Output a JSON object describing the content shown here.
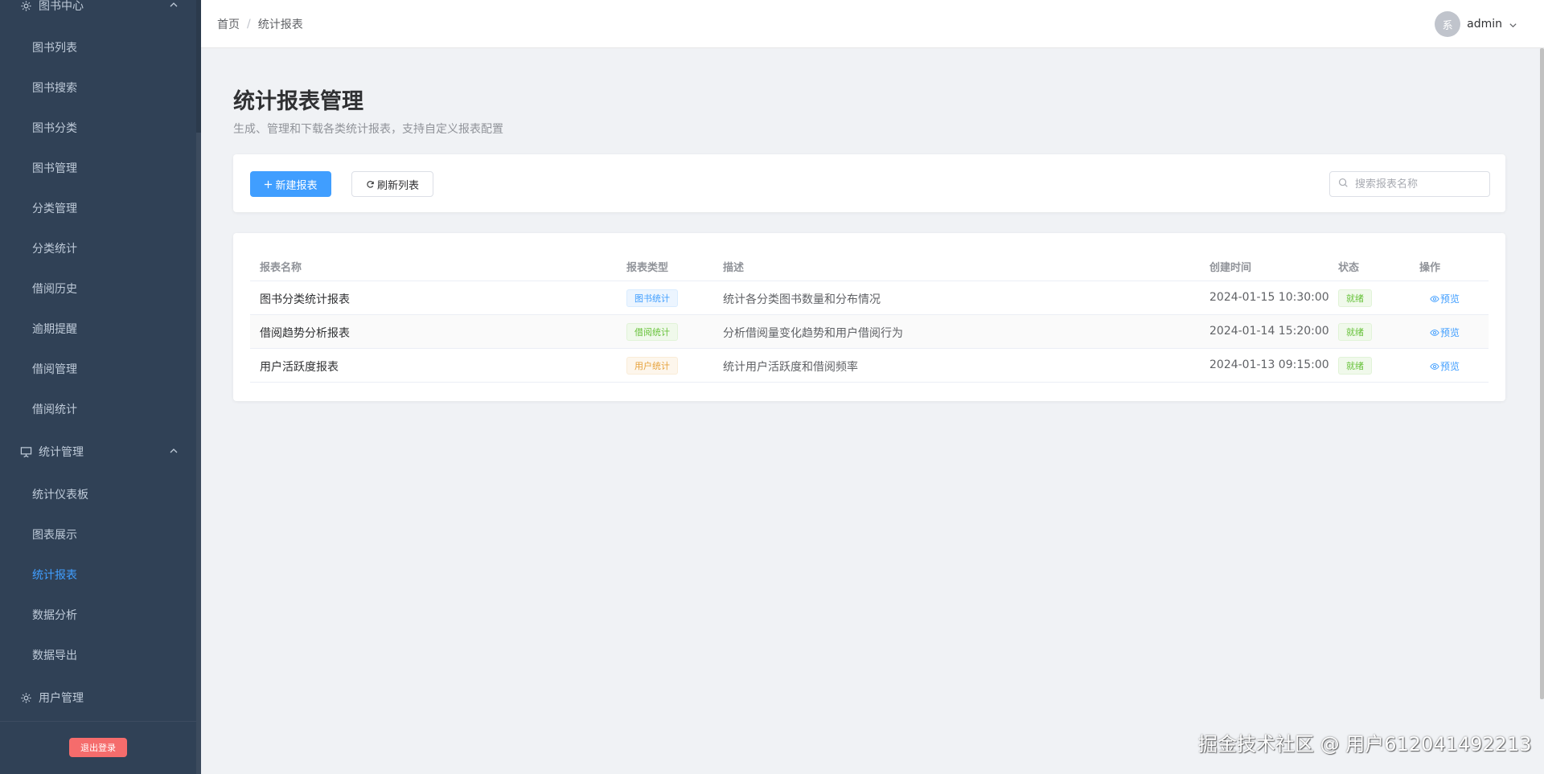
{
  "sidebar": {
    "group_books": {
      "label": "图书中心"
    },
    "book_items": [
      {
        "label": "图书列表"
      },
      {
        "label": "图书搜索"
      },
      {
        "label": "图书分类"
      },
      {
        "label": "图书管理"
      },
      {
        "label": "分类管理"
      },
      {
        "label": "分类统计"
      },
      {
        "label": "借阅历史"
      },
      {
        "label": "逾期提醒"
      },
      {
        "label": "借阅管理"
      },
      {
        "label": "借阅统计"
      }
    ],
    "group_stats": {
      "label": "统计管理"
    },
    "stats_items": [
      {
        "label": "统计仪表板"
      },
      {
        "label": "图表展示"
      },
      {
        "label": "统计报表",
        "active": true
      },
      {
        "label": "数据分析"
      },
      {
        "label": "数据导出"
      }
    ],
    "group_users": {
      "label": "用户管理"
    },
    "logout_label": "退出登录"
  },
  "header": {
    "breadcrumb": [
      "首页",
      "统计报表"
    ],
    "breadcrumb_separator": "/",
    "avatar_text": "系",
    "username": "admin"
  },
  "page": {
    "title": "统计报表管理",
    "subtitle": "生成、管理和下载各类统计报表，支持自定义报表配置"
  },
  "toolbar": {
    "new_report_label": "新建报表",
    "refresh_label": "刷新列表",
    "search_placeholder": "搜索报表名称"
  },
  "table": {
    "columns": [
      "报表名称",
      "报表类型",
      "描述",
      "创建时间",
      "状态",
      "操作"
    ],
    "rows": [
      {
        "name": "图书分类统计报表",
        "type": "图书统计",
        "type_color": "blue",
        "description": "统计各分类图书数量和分布情况",
        "created": "2024-01-15 10:30:00",
        "status": "就绪",
        "action": "预览"
      },
      {
        "name": "借阅趋势分析报表",
        "type": "借阅统计",
        "type_color": "green",
        "description": "分析借阅量变化趋势和用户借阅行为",
        "created": "2024-01-14 15:20:00",
        "status": "就绪",
        "action": "预览"
      },
      {
        "name": "用户活跃度报表",
        "type": "用户统计",
        "type_color": "orange",
        "description": "统计用户活跃度和借阅频率",
        "created": "2024-01-13 09:15:00",
        "status": "就绪",
        "action": "预览"
      }
    ]
  },
  "watermark": "掘金技术社区 @ 用户612041492213",
  "colors": {
    "sidebar_bg": "#304156",
    "sidebar_text": "#bfcbd9",
    "accent": "#409eff",
    "danger": "#f56c6c",
    "success": "#67c23a",
    "warning": "#e6a23c"
  }
}
